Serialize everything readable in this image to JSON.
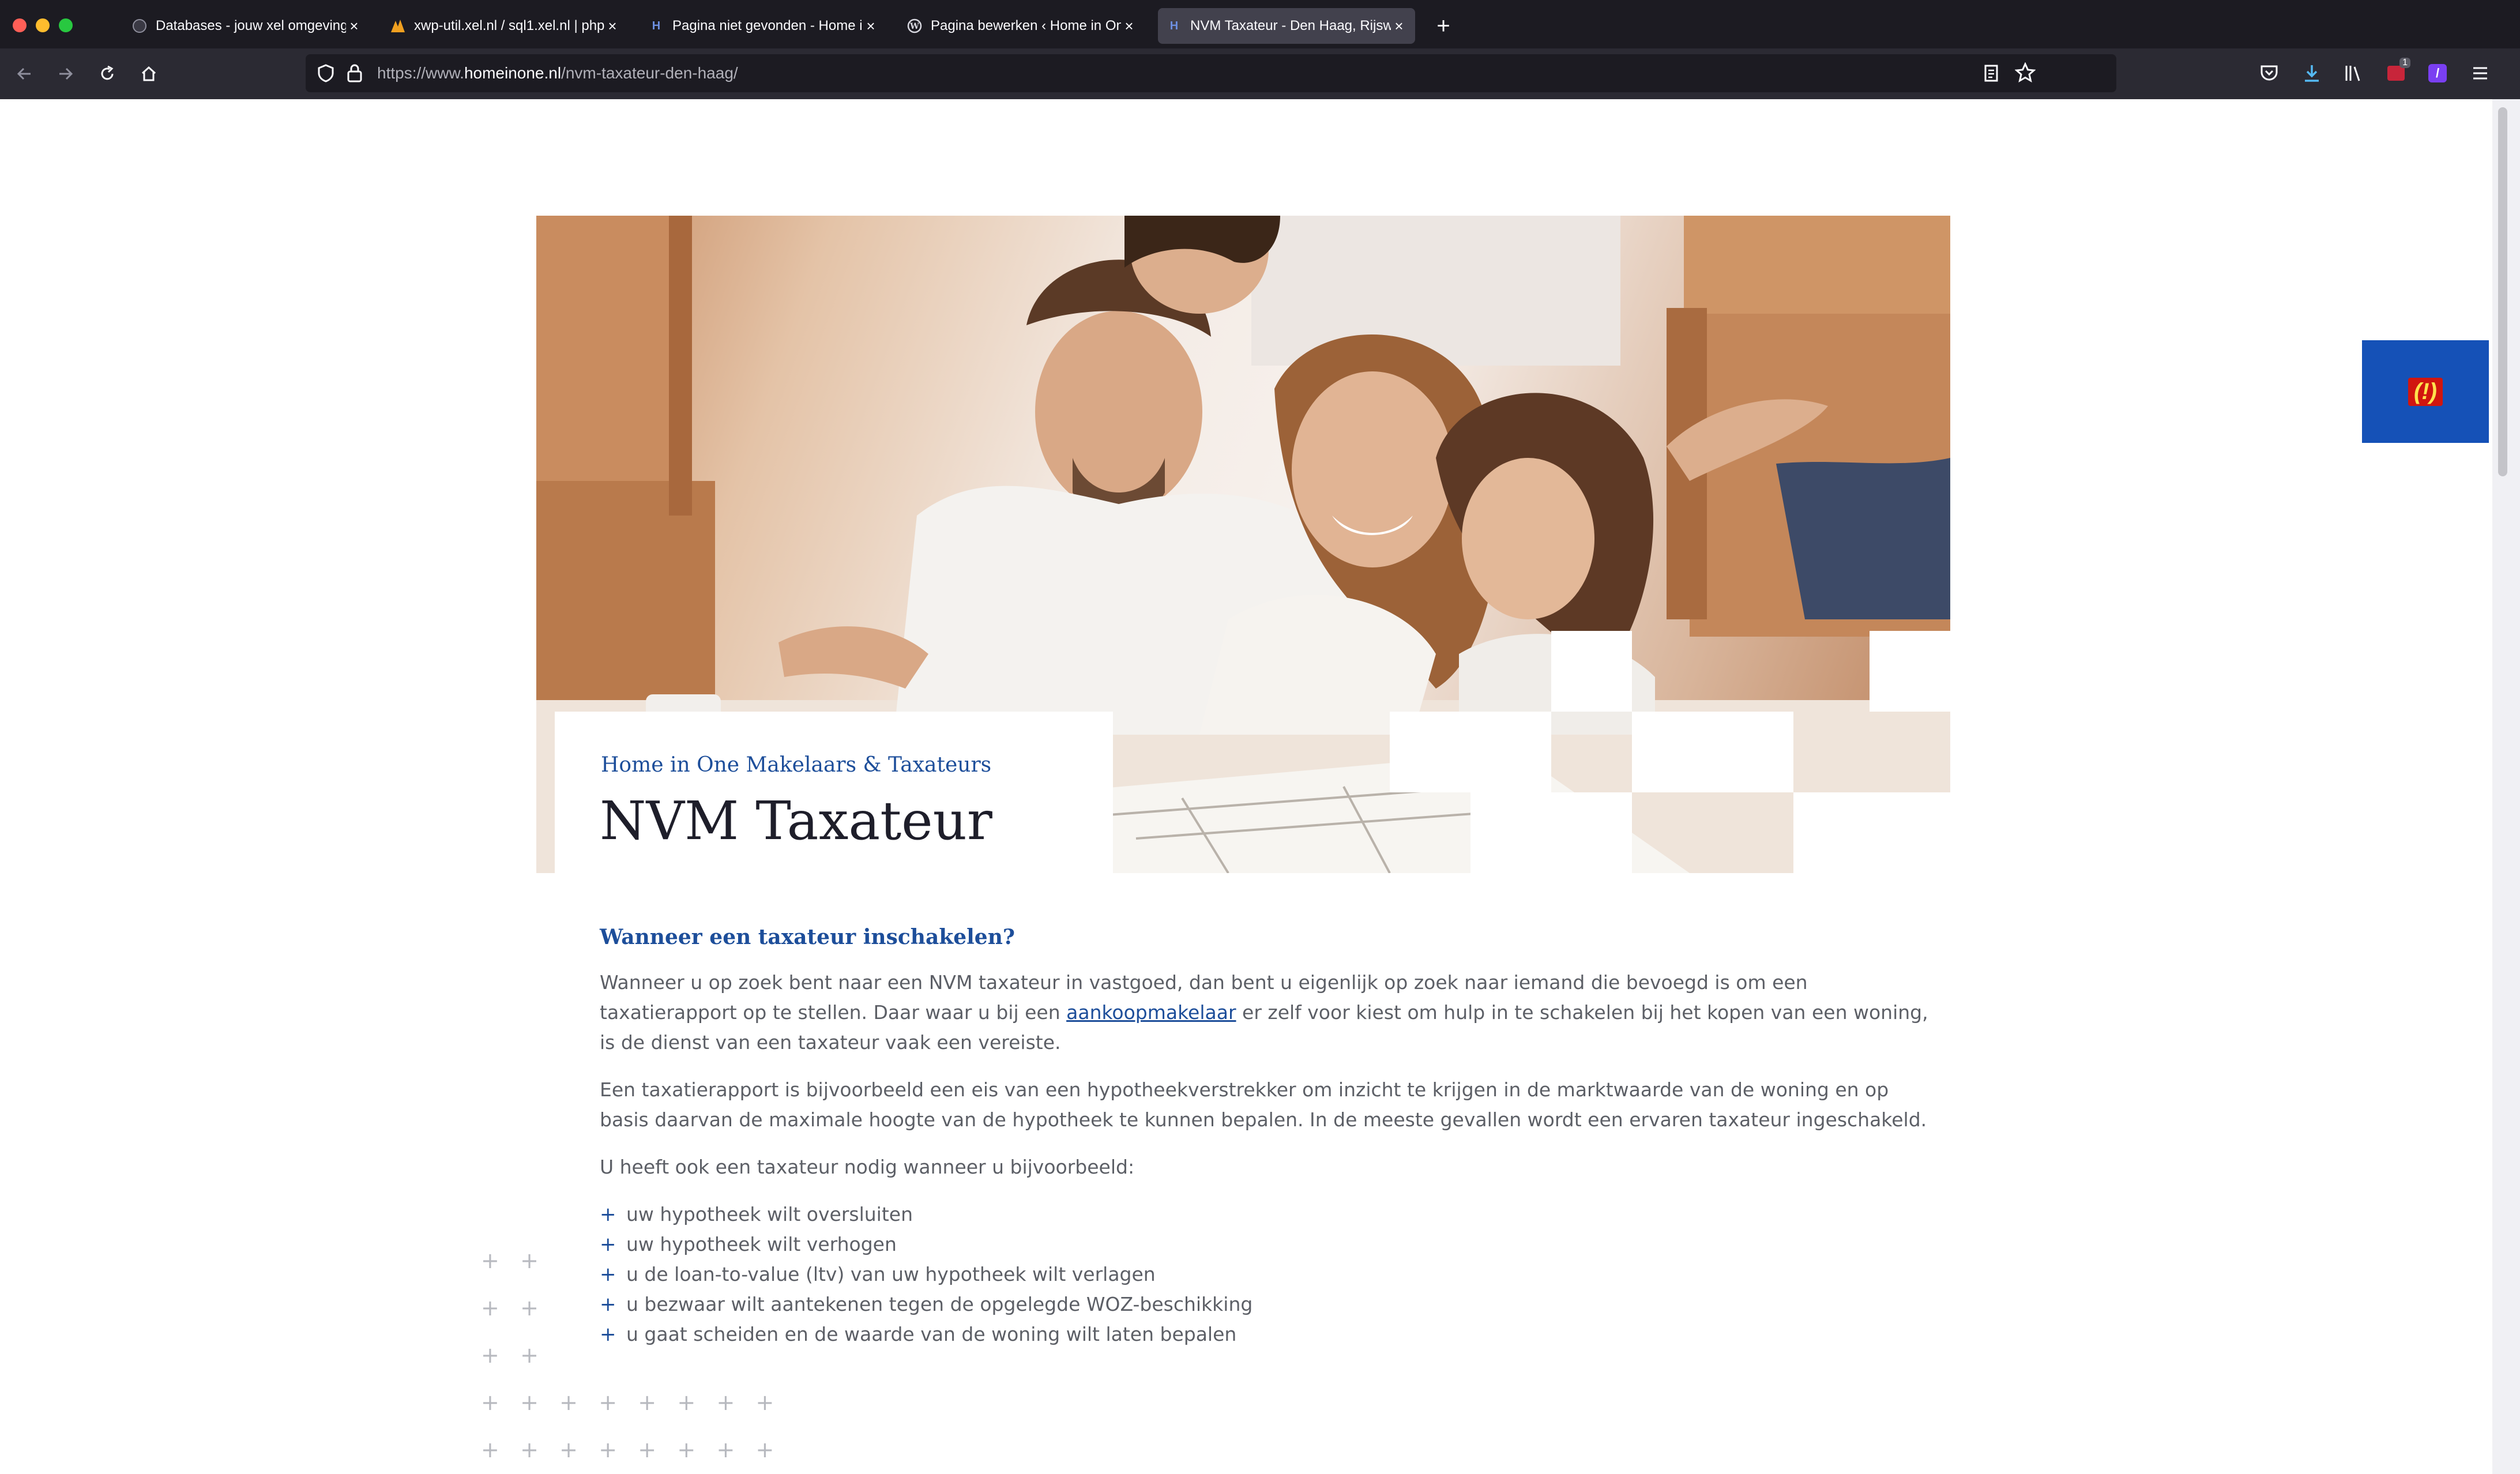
{
  "browser": {
    "tabs": [
      {
        "title": "Databases - jouw xel omgeving",
        "active": false
      },
      {
        "title": "xwp-util.xel.nl / sql1.xel.nl | php",
        "active": false
      },
      {
        "title": "Pagina niet gevonden - Home in On",
        "active": false
      },
      {
        "title": "Pagina bewerken ‹ Home in One",
        "active": false
      },
      {
        "title": "NVM Taxateur - Den Haag, Rijsw",
        "active": true
      }
    ],
    "new_tab": "+",
    "close_glyph": "×",
    "url": {
      "prefix": "https://www.",
      "domain": "homeinone.nl",
      "path": "/nvm-taxateur-den-haag/"
    },
    "download_badge": "1",
    "colors": {
      "chrome_dark": "#1c1b22",
      "toolbar": "#2b2a33",
      "active_tab": "#42414d",
      "accent": "#1d4e9a"
    }
  },
  "page": {
    "hero": {
      "subtitle": "Home in One Makelaars & Taxateurs",
      "title": "NVM Taxateur"
    },
    "feedback_label": "(!)",
    "section_heading": "Wanneer een taxateur inschakelen?",
    "para1_before": "Wanneer u op zoek bent naar een NVM taxateur in vastgoed, dan bent u eigenlijk op zoek naar iemand die bevoegd is om een taxatierapport op te stellen. Daar waar u bij een ",
    "para1_link": "aankoopmakelaar",
    "para1_after": " er zelf voor kiest om hulp in te schakelen bij het kopen van een woning, is de dienst van een taxateur vaak een vereiste.",
    "para2": "Een taxatierapport is bijvoorbeeld een eis van een hypotheekverstrekker om inzicht te krijgen in de marktwaarde van de woning en op basis daarvan de maximale hoogte van de hypotheek te kunnen bepalen. In de meeste gevallen wordt een ervaren taxateur ingeschakeld.",
    "para3": "U heeft ook een taxateur nodig wanneer u bijvoorbeeld:",
    "bullet_glyph": "+",
    "bullets": [
      "uw hypotheek wilt oversluiten",
      "uw hypotheek wilt verhogen",
      "u de loan-to-value (ltv) van uw hypotheek wilt verlagen",
      "u bezwaar wilt aantekenen tegen de opgelegde WOZ-beschikking",
      "u gaat scheiden en de waarde van de woning wilt laten bepalen"
    ]
  }
}
